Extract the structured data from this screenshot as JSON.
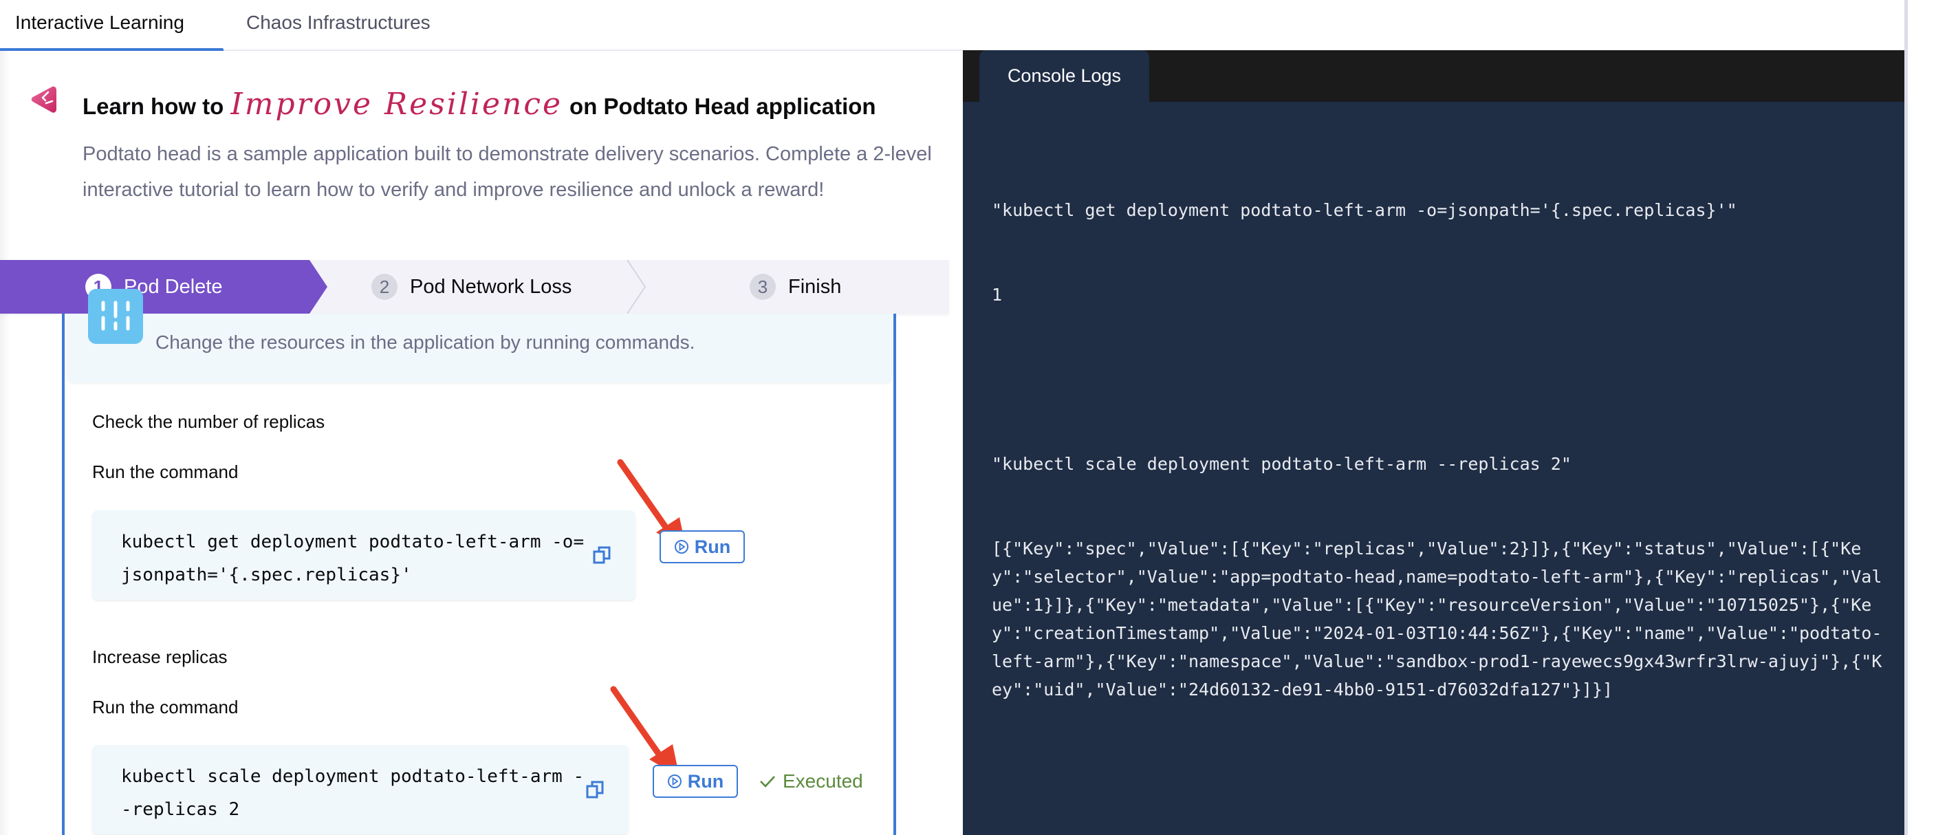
{
  "tabs": [
    {
      "label": "Interactive Learning",
      "active": true
    },
    {
      "label": "Chaos Infrastructures",
      "active": false
    }
  ],
  "header": {
    "title_prefix": "Learn how to",
    "title_highlight": "Improve Resilience",
    "title_suffix": "on Podtato Head application",
    "description": "Podtato head is a sample application built to demonstrate delivery scenarios. Complete a 2-level interactive tutorial to learn how to verify and improve resilience and unlock a reward!"
  },
  "stepper": {
    "steps": [
      {
        "number": "1",
        "label": "Pod Delete",
        "state": "active"
      },
      {
        "number": "2",
        "label": "Pod Network Loss",
        "state": "pending"
      },
      {
        "number": "3",
        "label": "Finish",
        "state": "pending"
      }
    ]
  },
  "card": {
    "info_text": "Change the resources in the application by running commands.",
    "tasks": [
      {
        "title": "Check the number of replicas",
        "instruction": "Run the command",
        "command": "kubectl get deployment podtato-left-arm -o=jsonpath='{.spec.replicas}'",
        "run_label": "Run",
        "status": ""
      },
      {
        "title": "Increase replicas",
        "instruction": "Run the command",
        "command": "kubectl scale deployment podtato-left-arm --replicas 2",
        "run_label": "Run",
        "status": "Executed"
      }
    ]
  },
  "console": {
    "tab_label": "Console Logs",
    "lines": [
      "\"kubectl get deployment podtato-left-arm -o=jsonpath='{.spec.replicas}'\"",
      "1",
      "",
      "\"kubectl scale deployment podtato-left-arm --replicas 2\"",
      "[{\"Key\":\"spec\",\"Value\":[{\"Key\":\"replicas\",\"Value\":2}]},{\"Key\":\"status\",\"Value\":[{\"Key\":\"selector\",\"Value\":\"app=podtato-head,name=podtato-left-arm\"},{\"Key\":\"replicas\",\"Value\":1}]},{\"Key\":\"metadata\",\"Value\":[{\"Key\":\"resourceVersion\",\"Value\":\"10715025\"},{\"Key\":\"creationTimestamp\",\"Value\":\"2024-01-03T10:44:56Z\"},{\"Key\":\"name\",\"Value\":\"podtato-left-arm\"},{\"Key\":\"namespace\",\"Value\":\"sandbox-prod1-rayewecs9gx43wrfr3lrw-ajuyj\"},{\"Key\":\"uid\",\"Value\":\"24d60132-de91-4bb0-9151-d76032dfa127\"}]}]"
    ]
  },
  "colors": {
    "accent_blue": "#3c7ad6",
    "step_active": "#7650c9",
    "highlight_script": "#c0245a",
    "executed_green": "#5b8a3c",
    "annotation_arrow": "#e8412b",
    "console_bg": "#1f2d45"
  }
}
